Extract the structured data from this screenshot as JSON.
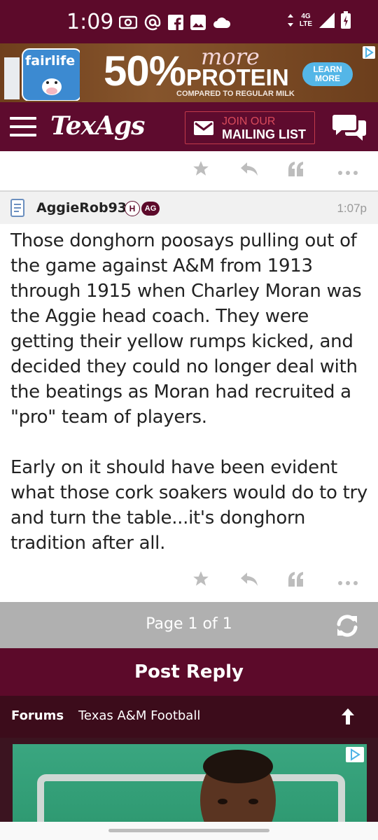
{
  "status_bar": {
    "time": "1:09",
    "network_label": "4G LTE",
    "icons_left": [
      "radio-icon",
      "at-icon",
      "facebook-icon",
      "image-icon",
      "cloud-icon"
    ],
    "icons_right": [
      "data-arrows-icon",
      "signal-icon",
      "battery-charging-icon"
    ]
  },
  "top_ad": {
    "brand": "fairlife",
    "headline_number": "50%",
    "headline_more": "more",
    "headline_word": "PROTEIN",
    "subtext": "COMPARED TO REGULAR MILK",
    "cta_line1": "LEARN",
    "cta_line2": "MORE"
  },
  "header": {
    "logo": "TexAgs",
    "mailing_line1": "JOIN OUR",
    "mailing_line2": "MAILING LIST"
  },
  "post": {
    "username": "AggieRob93",
    "badge_h": "H",
    "badge_ag": "AG",
    "time": "1:07p",
    "paragraphs": [
      "Those donghorn poosays pulling out of the game against A&M from 1913 through 1915 when Charley Moran was the Aggie head coach. They were getting their yellow rumps kicked, and decided they could no longer deal with the beatings as Moran had recruited a \"pro\" team of players.",
      "Early on it should have been evident what those cork soakers would do to try and turn the table...it's donghorn tradition after all."
    ]
  },
  "pager": {
    "text": "Page 1 of 1"
  },
  "post_reply": {
    "label": "Post Reply"
  },
  "breadcrumb": {
    "forums": "Forums",
    "subforum": "Texas A&M Football"
  },
  "colors": {
    "maroon": "#5c0a2a",
    "dark_maroon": "#3c0c1b",
    "pager_gray": "#b0b0b0"
  }
}
